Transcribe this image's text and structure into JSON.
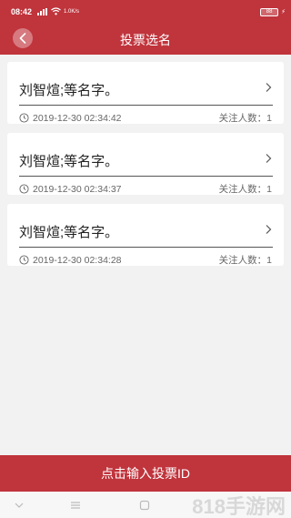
{
  "status_bar": {
    "time": "08:42",
    "network": "1.0K/s",
    "battery": "88"
  },
  "header": {
    "title": "投票选名"
  },
  "votes": [
    {
      "title": "刘智煊;等名字。",
      "timestamp": "2019-12-30 02:34:42",
      "followers_label": "关注人数：",
      "followers": "1"
    },
    {
      "title": "刘智煊;等名字。",
      "timestamp": "2019-12-30 02:34:37",
      "followers_label": "关注人数：",
      "followers": "1"
    },
    {
      "title": "刘智煊;等名字。",
      "timestamp": "2019-12-30 02:34:28",
      "followers_label": "关注人数：",
      "followers": "1"
    }
  ],
  "footer": {
    "button_label": "点击输入投票ID"
  },
  "watermark": "818手游网",
  "colors": {
    "primary": "#c0343c",
    "background": "#f2f2f2",
    "card": "#ffffff"
  },
  "icons": [
    "back-icon",
    "chevron-right-icon",
    "clock-icon",
    "signal-icon",
    "wifi-icon",
    "battery-icon"
  ]
}
